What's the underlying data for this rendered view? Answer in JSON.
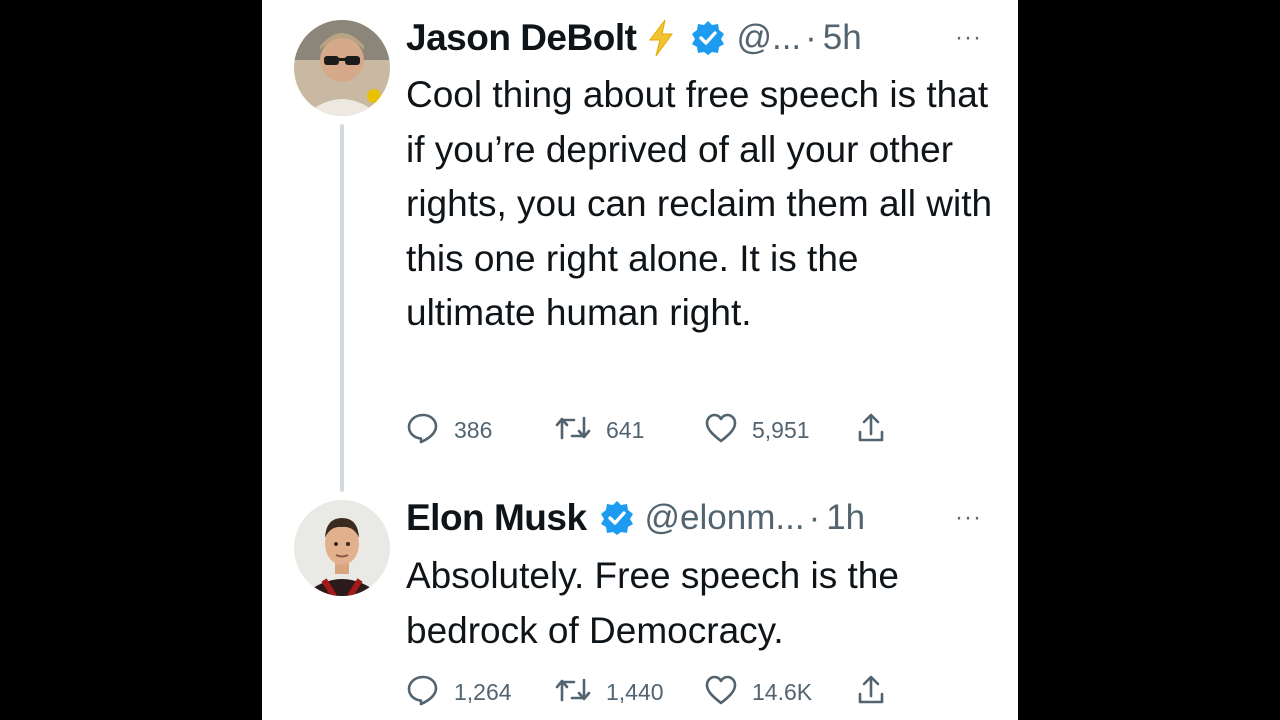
{
  "tweets": [
    {
      "name": "Jason DeBolt",
      "handle": "@...",
      "separator": "·",
      "time": "5h",
      "text": "Cool thing about free speech is that if you’re deprived of all your other rights, you can reclaim them all with this one right alone. It is the ultimate human right.",
      "replies": "386",
      "retweets": "641",
      "likes": "5,951",
      "more": "···"
    },
    {
      "name": "Elon Musk",
      "handle": "@elonm...",
      "separator": "·",
      "time": "1h",
      "text": "Absolutely. Free speech is the bedrock of Democracy.",
      "replies": "1,264",
      "retweets": "1,440",
      "likes": "14.6K",
      "more": "···"
    }
  ],
  "icons": {
    "reply": "reply-icon",
    "retweet": "retweet-icon",
    "like": "heart-icon",
    "share": "share-icon",
    "verified": "verified-badge-icon",
    "lightning": "lightning-icon"
  },
  "colors": {
    "background": "#000000",
    "card": "#ffffff",
    "text": "#0f1419",
    "secondary": "#536471",
    "verified": "#1d9bf0",
    "lightning": "#f4c430",
    "thread_line": "#cfd9de"
  }
}
